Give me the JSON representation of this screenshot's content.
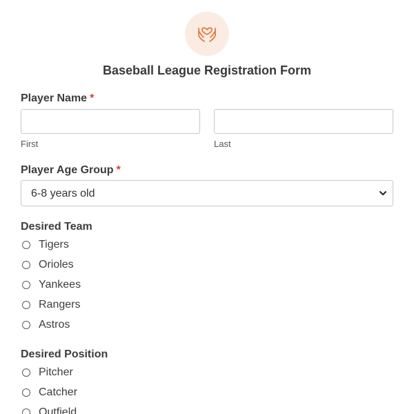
{
  "form": {
    "title": "Baseball League Registration Form",
    "logo_icon": "hands-heart-icon",
    "accent_color": "#e07b3f"
  },
  "player_name": {
    "label": "Player Name",
    "required_mark": "*",
    "first": {
      "value": "",
      "sublabel": "First"
    },
    "last": {
      "value": "",
      "sublabel": "Last"
    }
  },
  "age_group": {
    "label": "Player Age Group",
    "required_mark": "*",
    "selected": "6-8 years old"
  },
  "desired_team": {
    "label": "Desired Team",
    "options": [
      "Tigers",
      "Orioles",
      "Yankees",
      "Rangers",
      "Astros"
    ]
  },
  "desired_position": {
    "label": "Desired Position",
    "options": [
      "Pitcher",
      "Catcher",
      "Outfield"
    ]
  }
}
